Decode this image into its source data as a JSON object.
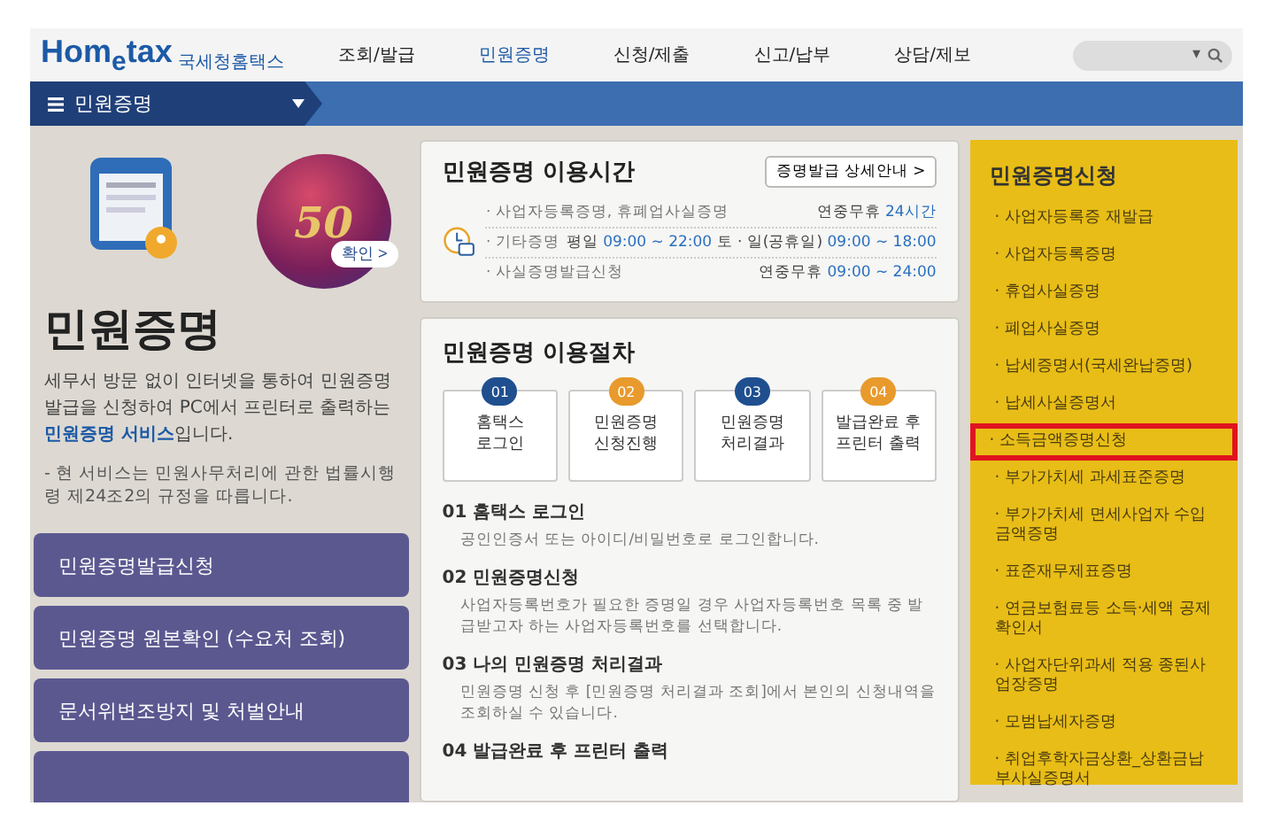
{
  "header": {
    "logo": "Hom$_{e}$tax",
    "logo_sub": "국세청홈택스",
    "nav": [
      {
        "label": "조회/발급",
        "selected": false
      },
      {
        "label": "민원증명",
        "selected": true
      },
      {
        "label": "신청/제출",
        "selected": false
      },
      {
        "label": "신고/납부",
        "selected": false
      },
      {
        "label": "상담/제보",
        "selected": false
      }
    ],
    "search": {
      "dropdown": "▾"
    }
  },
  "menu_bar": {
    "title": "민원증명"
  },
  "intro": {
    "badge": "50",
    "badge_button": "확인 >",
    "title": "민원증명",
    "description": "세무서 방문 없이 인터넷을 통하여 민원증명발급을 신청하여 PC에서 프린터로 출력하는 **민원증명 서비스**입니다.",
    "note": "- 현 서비스는 민원사무처리에 관한 법률시행령 제24조2의 규정을 따릅니다.",
    "buttons": [
      "민원증명발급신청",
      "민원증명 원본확인 (수요처 조회)",
      "문서위변조방지 및 처벌안내"
    ]
  },
  "hours": {
    "title": "민원증명 이용시간",
    "detail_button": "증명발급 상세안내 >",
    "rows": [
      {
        "name": "· 사업자등록증명, 휴폐업사실증명",
        "time": "연중무휴 **24시간**"
      },
      {
        "name": "· 기타증명",
        "time": "평일 **09:00 ~ 22:00**  토 · 일(공휴일) **09:00 ~ 18:00**"
      },
      {
        "name": "· 사실증명발급신청",
        "time": "연중무휴 **09:00 ~ 24:00**"
      }
    ]
  },
  "procedure": {
    "title": "민원증명 이용절차",
    "steps": [
      {
        "number": "01",
        "label": "홈택스\n로그인",
        "color": "#1f4f8f"
      },
      {
        "number": "02",
        "label": "민원증명\n신청진행",
        "color": "#e89a2c"
      },
      {
        "number": "03",
        "label": "민원증명\n처리결과",
        "color": "#1f4f8f"
      },
      {
        "number": "04",
        "label": "발급완료 후\n프린터 출력",
        "color": "#e89a2c"
      }
    ],
    "details": [
      {
        "heading": "01 홈택스 로그인",
        "text": "공인인증서 또는 아이디/비밀번호로 로그인합니다."
      },
      {
        "heading": "02 민원증명신청",
        "text": "사업자등록번호가 필요한 증명일 경우 사업자등록번호 목록 중 발급받고자 하는 사업자등록번호를 선택합니다."
      },
      {
        "heading": "03 나의 민원증명 처리결과",
        "text": "민원증명 신청 후 [민원증명 처리결과 조회]에서 본인의 신청내역을 조회하실 수 있습니다."
      },
      {
        "heading": "04 발급완료 후 프린터 출력"
      }
    ]
  },
  "sidebar": {
    "title": "민원증명신청",
    "items": [
      {
        "label": "· 사업자등록증 재발급",
        "selected": false
      },
      {
        "label": "· 사업자등록증명",
        "selected": false
      },
      {
        "label": "· 휴업사실증명",
        "selected": false
      },
      {
        "label": "· 폐업사실증명",
        "selected": false
      },
      {
        "label": "· 납세증명서(국세완납증명)",
        "selected": false
      },
      {
        "label": "· 납세사실증명서",
        "selected": false
      },
      {
        "label": "· 소득금액증명신청",
        "selected": true
      },
      {
        "label": "· 부가가치세 과세표준증명",
        "selected": false
      },
      {
        "label": "· 부가가치세 면세사업자 수입금액증명",
        "selected": false
      },
      {
        "label": "· 표준재무제표증명",
        "selected": false
      },
      {
        "label": "· 연금보험료등 소득·세액 공제확인서",
        "selected": false
      },
      {
        "label": "· 사업자단위과세 적용 종된사업장증명",
        "selected": false
      },
      {
        "label": "· 모범납세자증명",
        "selected": false
      },
      {
        "label": "· 취업후학자금상환_상환금납부사실증명서",
        "selected": false
      }
    ]
  }
}
